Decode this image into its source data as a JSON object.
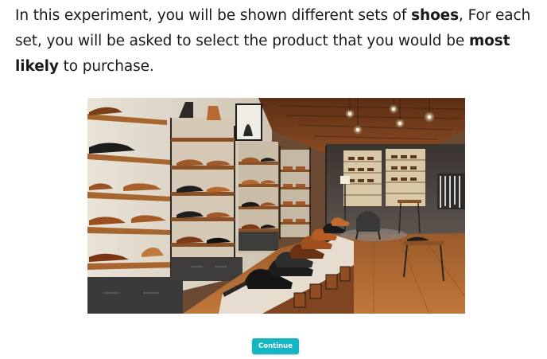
{
  "intro": {
    "part1": "In this experiment, you will be shown different sets of ",
    "bold1": "shoes",
    "part2": ", For each set, you will be asked to select the product that you would be ",
    "bold2": "most likely",
    "part3": " to purchase."
  },
  "image": {
    "subject": "shoe-store-interior"
  },
  "continue_label": "Continue",
  "colors": {
    "button": "#14b6c4",
    "text": "#1a1a1a"
  }
}
